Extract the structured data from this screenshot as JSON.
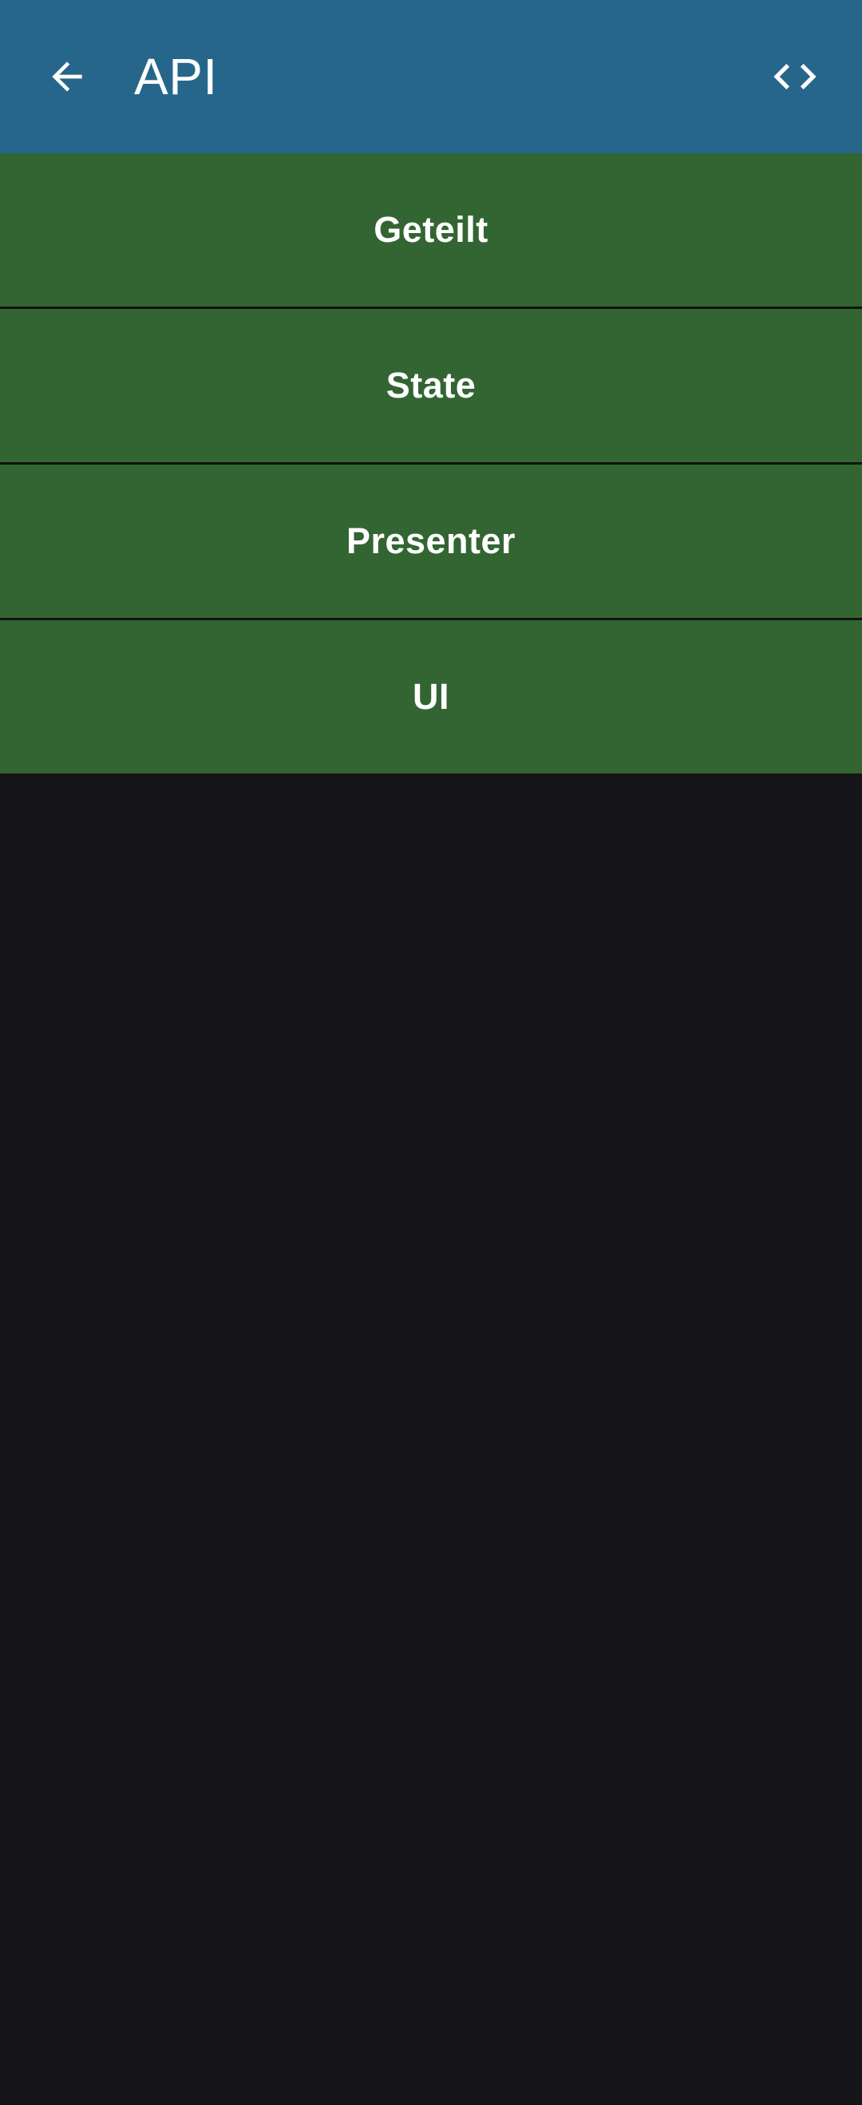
{
  "toolbar": {
    "title": "API",
    "back_icon": "arrow-left-icon",
    "action_icon": "code-icon",
    "background": "#27668b"
  },
  "list": {
    "item_color": "#336533",
    "items": [
      {
        "label": "Geteilt"
      },
      {
        "label": "State"
      },
      {
        "label": "Presenter"
      },
      {
        "label": "UI"
      }
    ]
  },
  "page_background": "#141419"
}
